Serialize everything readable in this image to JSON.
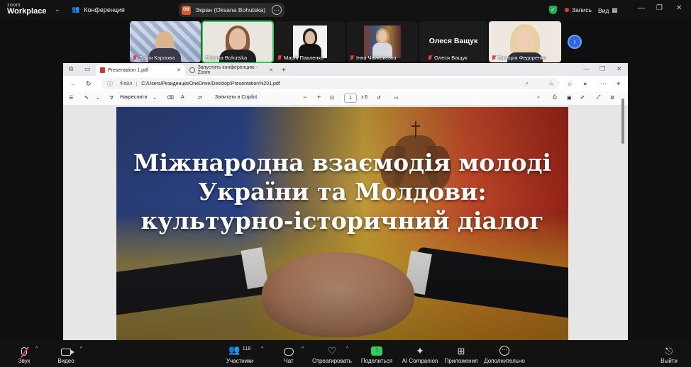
{
  "app": {
    "brand_small": "zoom",
    "brand_large": "Workplace",
    "meeting_title": "Конференция",
    "screen_share_label": "Экран (Oksana Bohutska)",
    "sharer_initials": "OB",
    "record_label": "Запись",
    "view_label": "Вид",
    "colors": {
      "accent_green": "#2dcd5c",
      "rec_red": "#e83a3a",
      "bg": "#121212"
    }
  },
  "participants": [
    {
      "name": "Дарія Карпова",
      "muted": true
    },
    {
      "name": "Oksana Bohutska",
      "muted": false,
      "active": true
    },
    {
      "name": "Марія Павленко",
      "muted": true
    },
    {
      "name": "Інна Чайковська",
      "muted": true
    },
    {
      "name": "Олеся Ващук",
      "display_name": "Олеся Ващук",
      "muted": true,
      "video_off": true
    },
    {
      "name": "Вікторія Федоренко",
      "muted": true
    }
  ],
  "browser": {
    "tabs": [
      {
        "label": "Presentation 1.pdf",
        "icon": "pdf-icon",
        "selected": true
      },
      {
        "label": "Запустить конференцию - Zoom",
        "icon": "globe-icon",
        "selected": false
      }
    ],
    "new_tab": "+",
    "address": {
      "prefix": "Файл",
      "url": "C:/Users/Резиденція/OneDrive/Desktop/Presentation%201.pdf"
    },
    "toolbar": {
      "draw_label": "Накреслити",
      "copilot_label": "Запитати в Copilot",
      "zoom_minus": "−",
      "zoom_plus": "+",
      "page_current": "1",
      "page_total": "з 6"
    }
  },
  "slide": {
    "title": "Міжнародна взаємодія молоді України та Молдови: культурно-історичний діалог"
  },
  "bottombar": {
    "audio": "Звук",
    "video": "Видео",
    "participants": "Участники",
    "participants_count": "118",
    "chat": "Чат",
    "react": "Отреагировать",
    "share": "Поделиться",
    "ai": "AI Companion",
    "apps": "Приложения",
    "more": "Дополнительно",
    "leave": "Выйти"
  }
}
